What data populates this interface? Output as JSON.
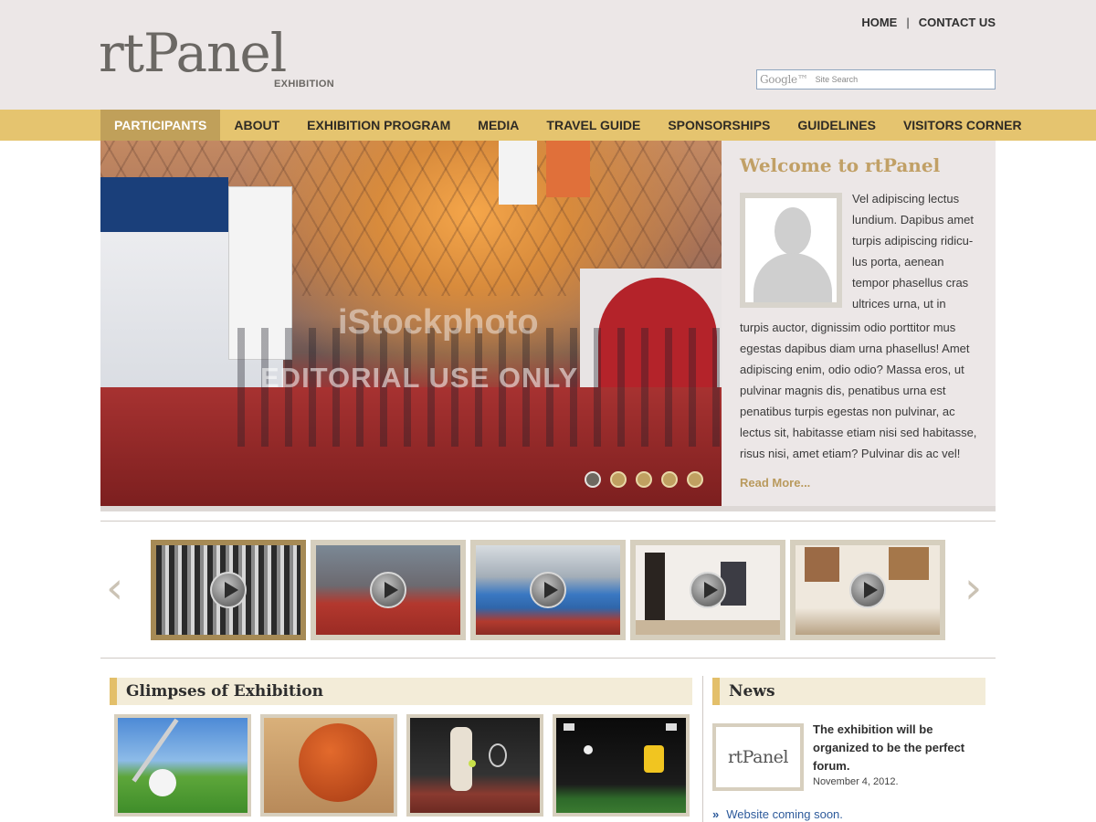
{
  "header": {
    "logo_text": "rtPanel",
    "logo_sub": "EXHIBITION",
    "top_links": [
      "HOME",
      "CONTACT US"
    ],
    "top_sep": "|",
    "search": {
      "brand": "Google™",
      "placeholder": "Site Search"
    }
  },
  "nav": {
    "items": [
      "PARTICIPANTS",
      "ABOUT",
      "EXHIBITION PROGRAM",
      "MEDIA",
      "TRAVEL GUIDE",
      "SPONSORSHIPS",
      "GUIDELINES",
      "VISITORS CORNER"
    ],
    "active_index": 0
  },
  "hero": {
    "watermark_logo": "iStockphoto",
    "watermark_text": "EDITORIAL USE ONLY",
    "dots_count": 5,
    "active_dot": 0
  },
  "welcome": {
    "title": "Welcome to rtPanel",
    "para1": "Vel adipiscing lectus lundium. Dapibus amet turpis adipiscing ridicu-lus porta, aenean tempor phasellus cras ultrices urna, ut in",
    "para2": "turpis auctor, dignissim odio porttitor mus egestas dapibus diam urna phasellus! Amet adipiscing enim, odio odio? Massa eros, ut pulvinar magnis dis, penatibus urna est penatibus turpis egestas non pulvinar, ac lectus sit, habitasse etiam nisi sed habitasse, risus nisi, amet etiam? Pulvinar dis ac vel!",
    "read_more": "Read More..."
  },
  "carousel": {
    "prev": "‹",
    "next": "›",
    "videos": [
      "crowd",
      "walkers",
      "expo-booths",
      "gallery-paintings",
      "gallery-visitor"
    ],
    "active_index": 0
  },
  "glimpses": {
    "title": "Glimpses of Exhibition",
    "images": [
      "golf",
      "basketball",
      "tennis",
      "soccer"
    ]
  },
  "news": {
    "title": "News",
    "thumb_text": "rtPanel",
    "item_title": "The exhibition will be organized to be the perfect forum.",
    "item_date": "November 4, 2012.",
    "link_bullet": "»",
    "link_text": "Website coming soon."
  },
  "colors": {
    "nav_bg": "#e5c46f",
    "nav_active": "#c0a05a",
    "header_bg": "#ece7e7",
    "accent_gold": "#c1a066",
    "link_blue": "#2d5a9b"
  }
}
